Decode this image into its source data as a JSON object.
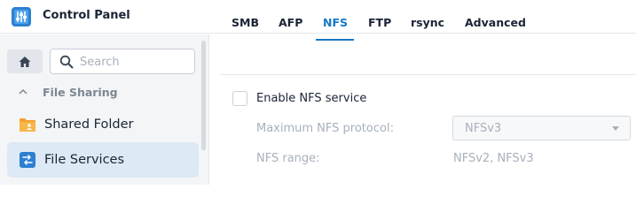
{
  "window": {
    "title": "Control Panel",
    "icon": "control-panel-icon"
  },
  "sidebar": {
    "home_icon": "home-icon",
    "search": {
      "placeholder": "Search",
      "value": ""
    },
    "section": {
      "label": "File Sharing",
      "expanded": true,
      "chevron_icon": "chevron-up-icon"
    },
    "items": [
      {
        "label": "Shared Folder",
        "icon": "shared-folder-icon",
        "active": false
      },
      {
        "label": "File Services",
        "icon": "file-services-icon",
        "active": true
      }
    ]
  },
  "tabs": [
    {
      "label": "SMB",
      "active": false
    },
    {
      "label": "AFP",
      "active": false
    },
    {
      "label": "NFS",
      "active": true
    },
    {
      "label": "FTP",
      "active": false
    },
    {
      "label": "rsync",
      "active": false
    },
    {
      "label": "Advanced",
      "active": false
    }
  ],
  "nfs": {
    "enable_label": "Enable NFS service",
    "enabled": false,
    "max_protocol_label": "Maximum NFS protocol:",
    "max_protocol_value": "NFSv3",
    "range_label": "NFS range:",
    "range_value": "NFSv2, NFSv3"
  },
  "colors": {
    "accent": "#1478c8",
    "active_bg": "#dde9f5",
    "sidebar_bg": "#f3f5f7",
    "disabled_text": "#a7b0bb"
  }
}
